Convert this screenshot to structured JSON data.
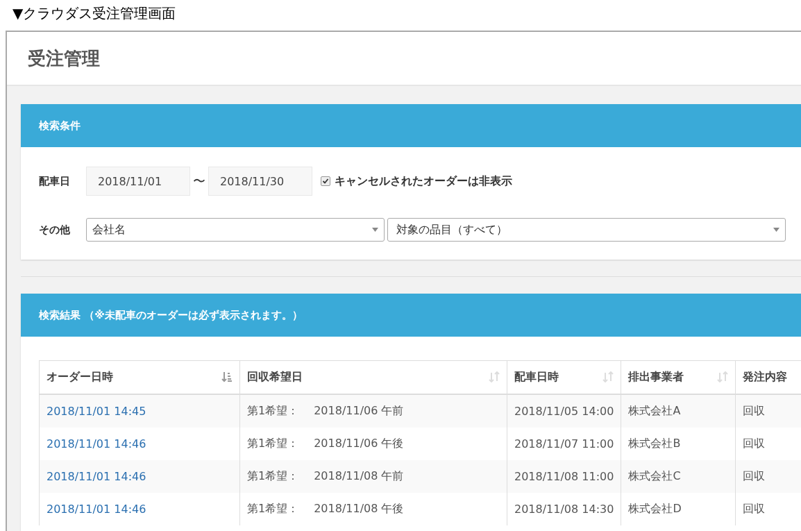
{
  "caption": "▼クラウダス受注管理画面",
  "page_title": "受注管理",
  "search_panel": {
    "title": "検索条件",
    "date_label": "配車日",
    "date_from": "2018/11/01",
    "date_separator": "〜",
    "date_to": "2018/11/30",
    "hide_cancelled": {
      "label": "キャンセルされたオーダーは非表示",
      "checked": true
    },
    "other_label": "その他",
    "selects": [
      {
        "value": "会社名"
      },
      {
        "value": "対象の品目（すべて）"
      }
    ]
  },
  "results_panel": {
    "title": "検索結果 （※未配車のオーダーは必ず表示されます。）",
    "table": {
      "columns": [
        {
          "label": "オーダー日時",
          "kind": "sorted"
        },
        {
          "label": "回収希望日",
          "kind": "sortable"
        },
        {
          "label": "配車日時",
          "kind": "sortable"
        },
        {
          "label": "排出事業者",
          "kind": "sortable"
        },
        {
          "label": "発注内容",
          "kind": "plain"
        }
      ],
      "rows": [
        {
          "order_time": "2018/11/01 14:45",
          "pickup_label": "第1希望：",
          "pickup_date": "2018/11/06 午前",
          "dispatch": "2018/11/05 14:00",
          "company": "株式会社A",
          "content": "回収"
        },
        {
          "order_time": "2018/11/01 14:46",
          "pickup_label": "第1希望：",
          "pickup_date": "2018/11/06 午後",
          "dispatch": "2018/11/07 11:00",
          "company": "株式会社B",
          "content": "回収"
        },
        {
          "order_time": "2018/11/01 14:46",
          "pickup_label": "第1希望：",
          "pickup_date": "2018/11/08 午前",
          "dispatch": "2018/11/08 11:00",
          "company": "株式会社C",
          "content": "回収"
        },
        {
          "order_time": "2018/11/01 14:46",
          "pickup_label": "第1希望：",
          "pickup_date": "2018/11/08 午後",
          "dispatch": "2018/11/08 14:30",
          "company": "株式会社D",
          "content": "回収"
        }
      ]
    }
  }
}
